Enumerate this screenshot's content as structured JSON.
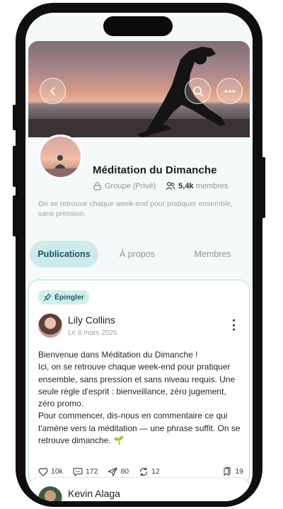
{
  "cover": {
    "back_icon": "chevron-left-icon",
    "search_icon": "search-icon",
    "more_icon": "more-horizontal-icon"
  },
  "group": {
    "title": "Méditation du Dimanche",
    "privacy_label": "Groupe (Privé)",
    "members_count": "5,4k",
    "members_label": "membres",
    "description": "On se retrouve chaque week-end pour pratiquer ensemble, sans pression."
  },
  "tabs": [
    {
      "label": "Publications",
      "active": true
    },
    {
      "label": "À propos",
      "active": false
    },
    {
      "label": "Membres",
      "active": false
    }
  ],
  "pinned_post": {
    "pin_label": "Épingler",
    "author": "Lily Collins",
    "date": "Le 8 mars 2026",
    "body": "Bienvenue dans Méditation du Dimanche !\nIci, on se retrouve chaque week-end pour pratiquer ensemble, sans pression et sans niveau requis. Une seule règle d'esprit : bienveillance, zéro jugement, zéro promo.\nPour commencer, dis-nous en commentaire ce qui t'amène vers la méditation — une phrase suffit. On se retrouve dimanche. 🌱",
    "likes": "10k",
    "comments": "172",
    "shares": "80",
    "reposts": "12",
    "saves": "19"
  },
  "next_post": {
    "author": "Kevin Alaga"
  },
  "colors": {
    "accent": "#cdebec",
    "accent_text": "#1e5560",
    "card_border": "#a9dedf"
  }
}
